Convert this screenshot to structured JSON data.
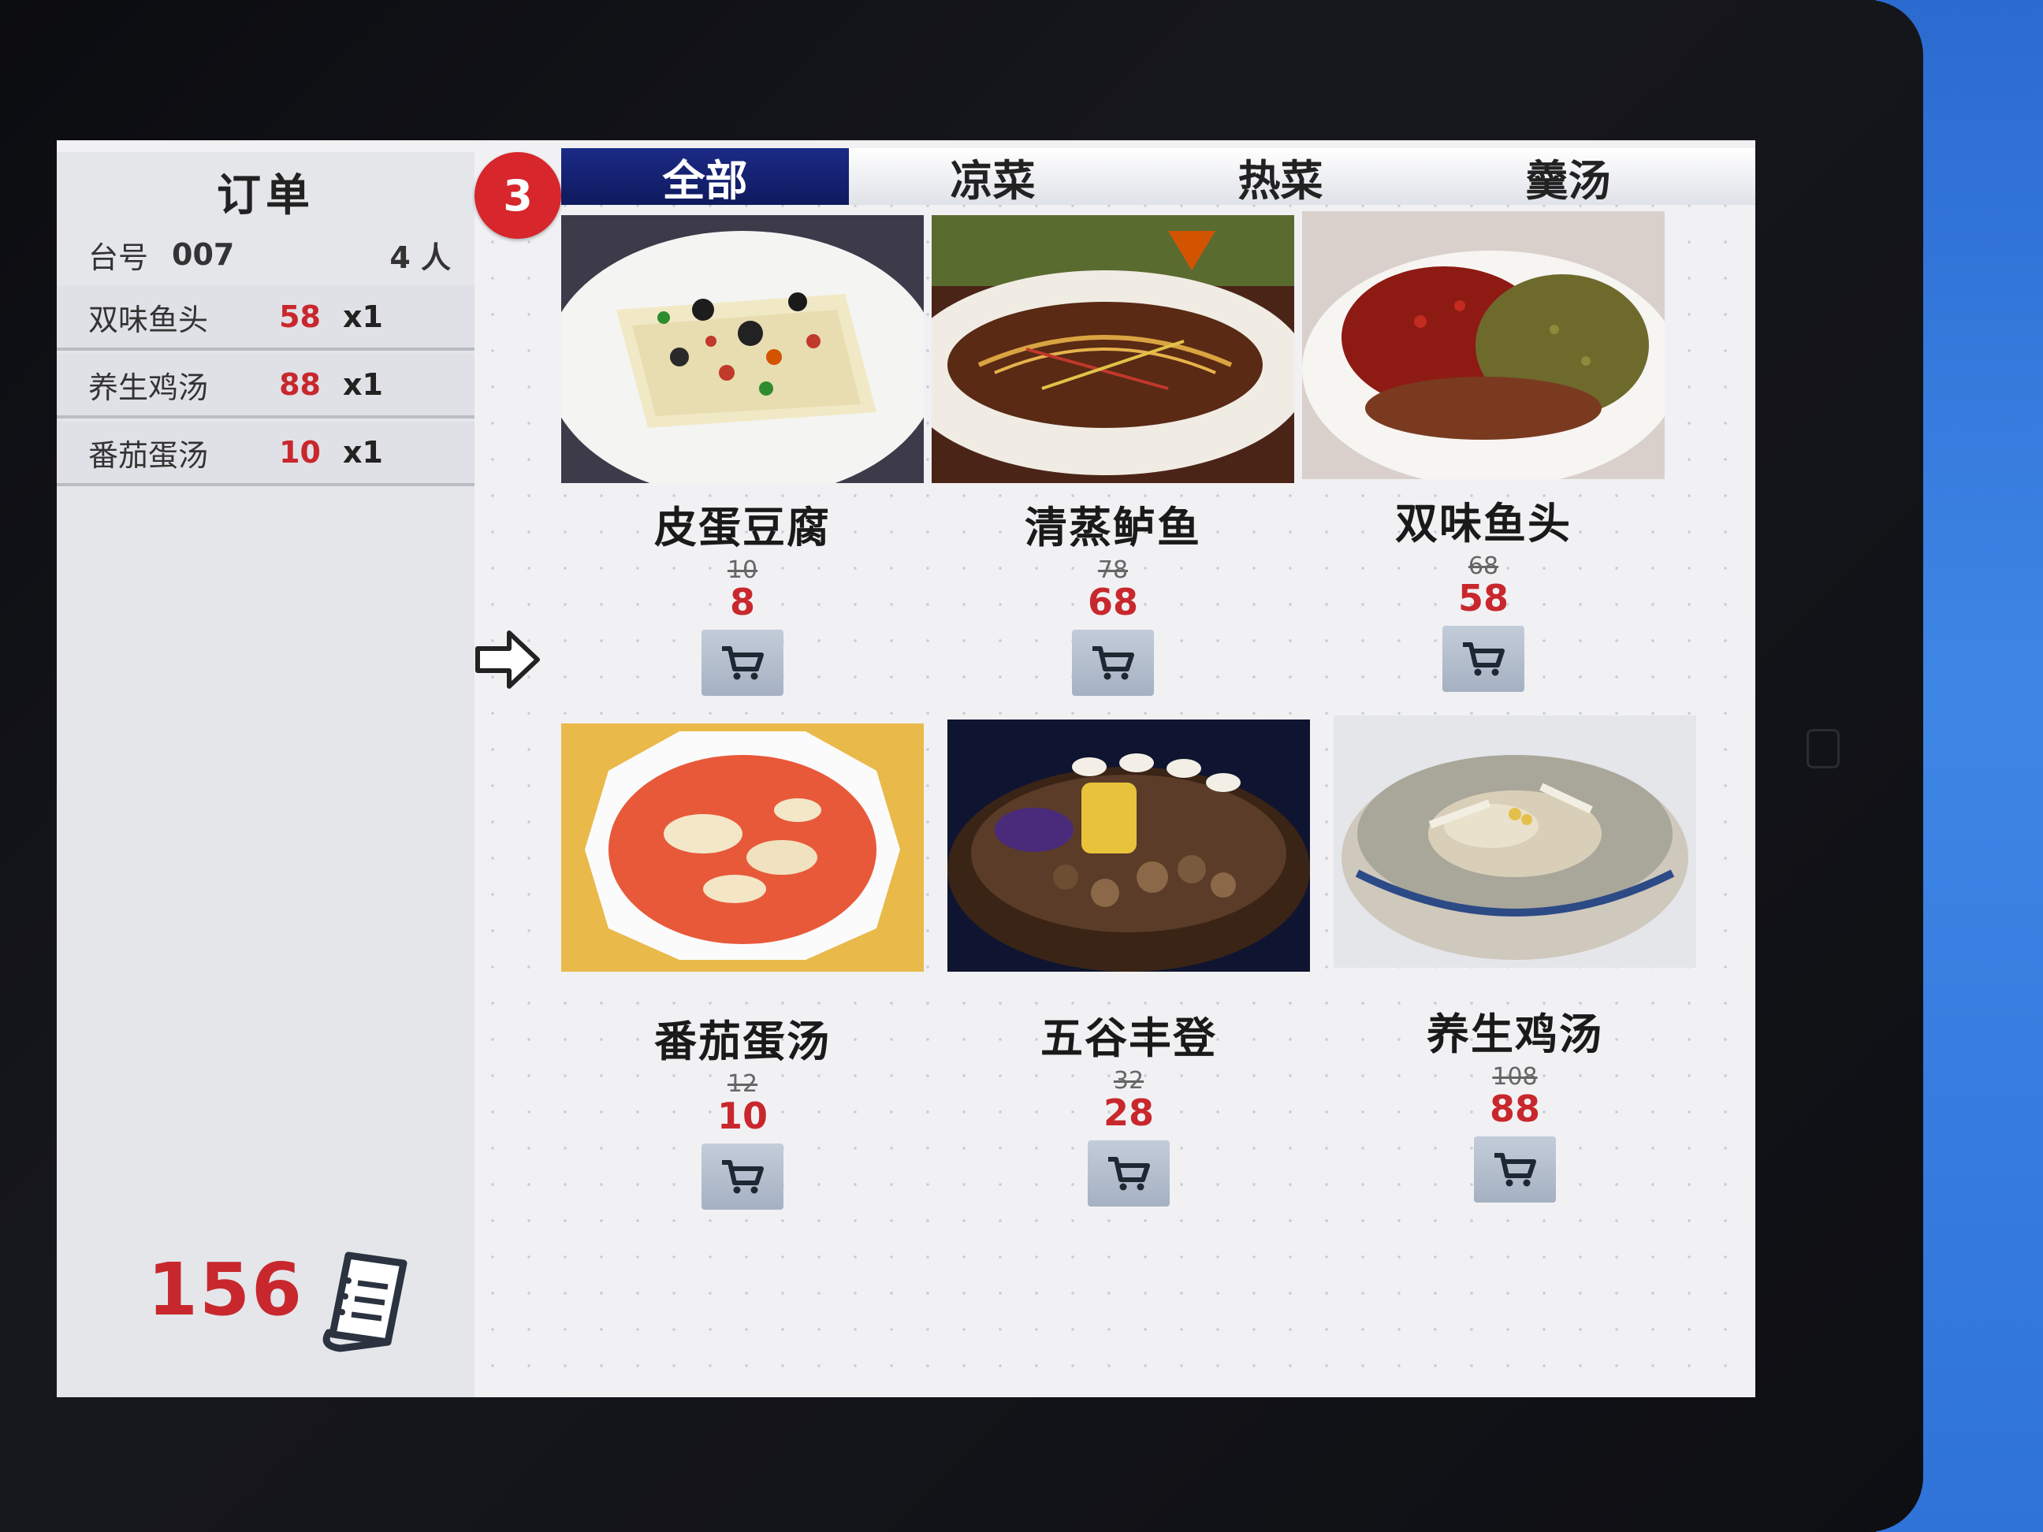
{
  "sidebar": {
    "title": "订单",
    "table_label": "台号",
    "table_no": "007",
    "guests": "4 人",
    "items": [
      {
        "name": "双味鱼头",
        "price": "58",
        "qty": "x1"
      },
      {
        "name": "养生鸡汤",
        "price": "88",
        "qty": "x1"
      },
      {
        "name": "番茄蛋汤",
        "price": "10",
        "qty": "x1"
      }
    ],
    "total": "156"
  },
  "cart_badge": "3",
  "tabs": [
    {
      "label": "全部",
      "active": true
    },
    {
      "label": "凉菜",
      "active": false
    },
    {
      "label": "热菜",
      "active": false
    },
    {
      "label": "羹汤",
      "active": false
    }
  ],
  "dishes": [
    {
      "name": "皮蛋豆腐",
      "old_price": "10",
      "price": "8"
    },
    {
      "name": "清蒸鲈鱼",
      "old_price": "78",
      "price": "68"
    },
    {
      "name": "双味鱼头",
      "old_price": "68",
      "price": "58"
    },
    {
      "name": "番茄蛋汤",
      "old_price": "12",
      "price": "10"
    },
    {
      "name": "五谷丰登",
      "old_price": "32",
      "price": "28"
    },
    {
      "name": "养生鸡汤",
      "old_price": "108",
      "price": "88"
    }
  ],
  "icons": {
    "badge": "red-circle",
    "next": "arrow-right-icon",
    "cart": "shopping-cart-icon",
    "receipt": "receipt-icon"
  },
  "colors": {
    "accent_red": "#c8282d",
    "active_tab": "#13207a",
    "cart_button": "#b3bdcc"
  }
}
